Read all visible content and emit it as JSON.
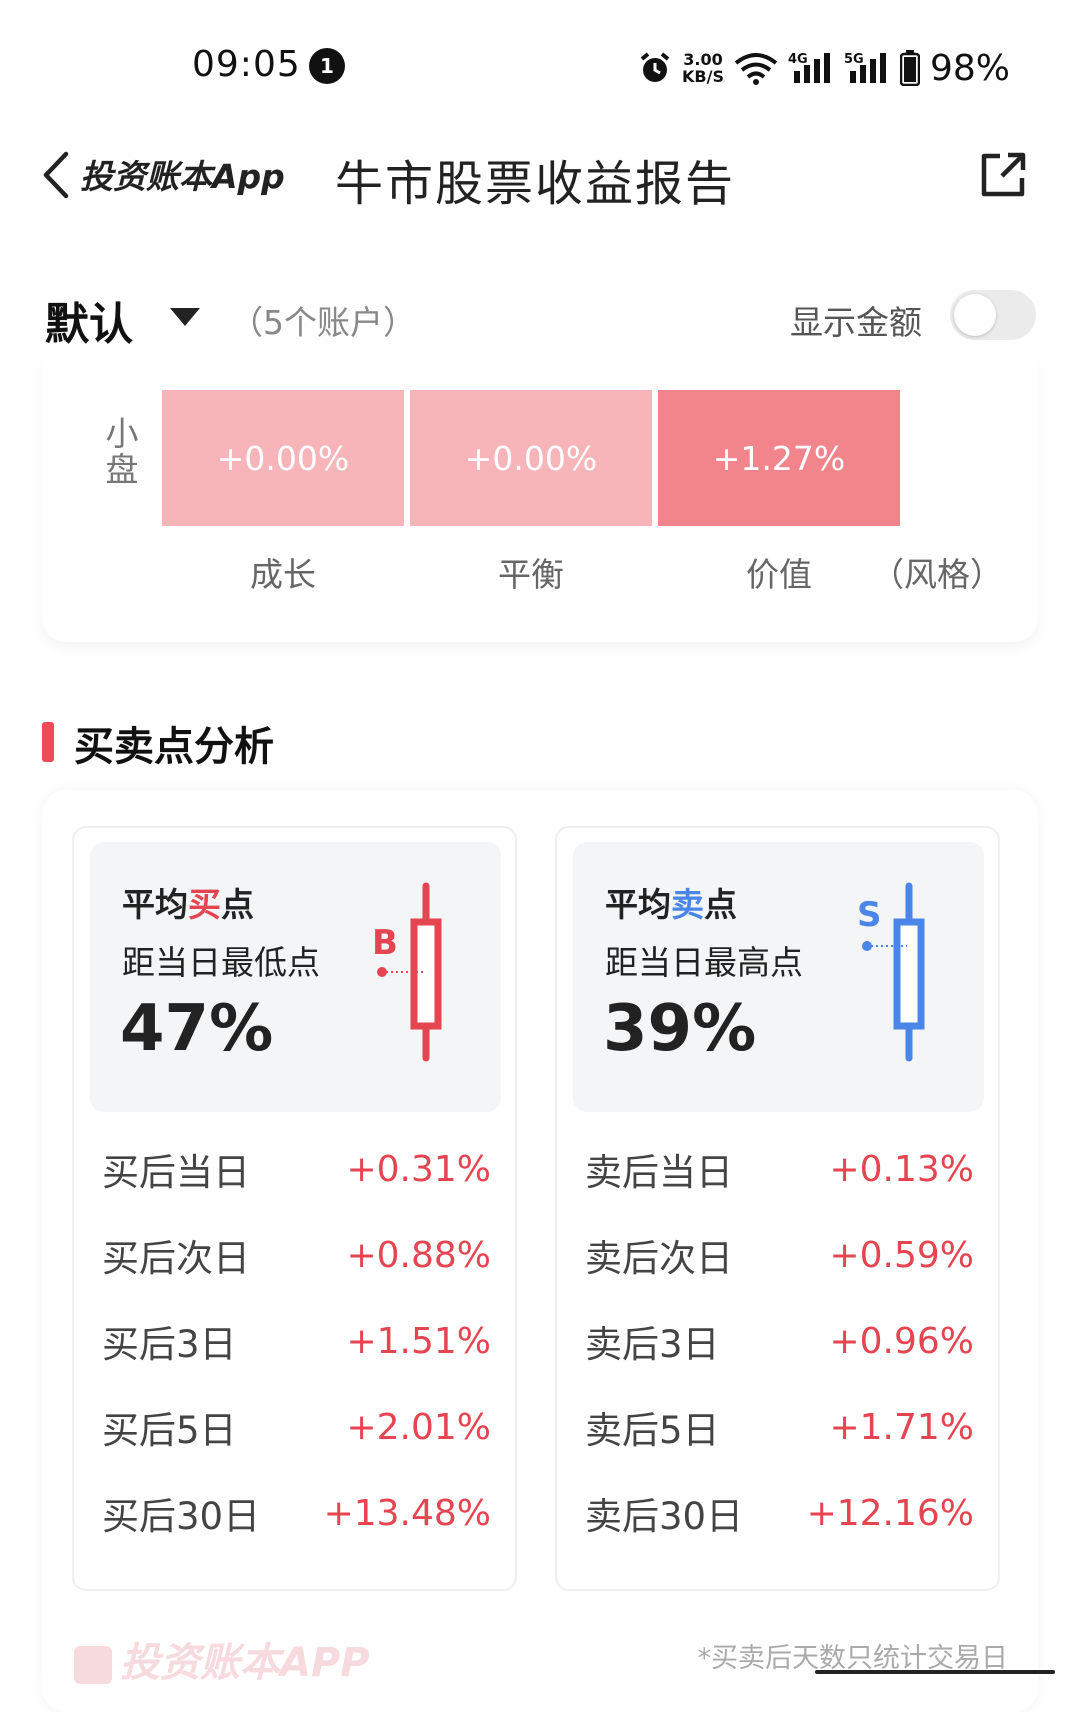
{
  "status_bar": {
    "time": "09:05",
    "notification_count": "1",
    "net_speed_value": "3.00",
    "net_speed_unit": "KB/S",
    "signal1_label": "4G",
    "signal2_label": "5G",
    "battery": "98%"
  },
  "nav": {
    "brand": "投资账本App",
    "title": "牛市股票收益报告"
  },
  "account": {
    "name": "默认",
    "count": "（5个账户）",
    "show_amount_label": "显示金额",
    "show_amount_on": false
  },
  "heatmap": {
    "row_label": "小盘",
    "cells": [
      {
        "value": "+0.00%",
        "color": "#f7b5b9"
      },
      {
        "value": "+0.00%",
        "color": "#f7b5b9"
      },
      {
        "value": "+1.27%",
        "color": "#f1858b"
      }
    ],
    "columns": [
      "成长",
      "平衡",
      "价值"
    ],
    "axis_label": "（风格）"
  },
  "section": {
    "title": "买卖点分析"
  },
  "buy_card": {
    "title_prefix": "平均",
    "title_key": "买",
    "title_suffix": "点",
    "subtitle": "距当日最低点",
    "percent": "47%",
    "marker": "B",
    "accent": "#e54551",
    "rows": [
      {
        "label": "买后当日",
        "value": "+0.31%"
      },
      {
        "label": "买后次日",
        "value": "+0.88%"
      },
      {
        "label": "买后3日",
        "value": "+1.51%"
      },
      {
        "label": "买后5日",
        "value": "+2.01%"
      },
      {
        "label": "买后30日",
        "value": "+13.48%"
      }
    ]
  },
  "sell_card": {
    "title_prefix": "平均",
    "title_key": "卖",
    "title_suffix": "点",
    "subtitle": "距当日最高点",
    "percent": "39%",
    "marker": "S",
    "accent": "#4a86e8",
    "rows": [
      {
        "label": "卖后当日",
        "value": "+0.13%"
      },
      {
        "label": "卖后次日",
        "value": "+0.59%"
      },
      {
        "label": "卖后3日",
        "value": "+0.96%"
      },
      {
        "label": "卖后5日",
        "value": "+1.71%"
      },
      {
        "label": "卖后30日",
        "value": "+12.16%"
      }
    ]
  },
  "footer": {
    "watermark": "投资账本APP",
    "note": "*买卖后天数只统计交易日"
  }
}
